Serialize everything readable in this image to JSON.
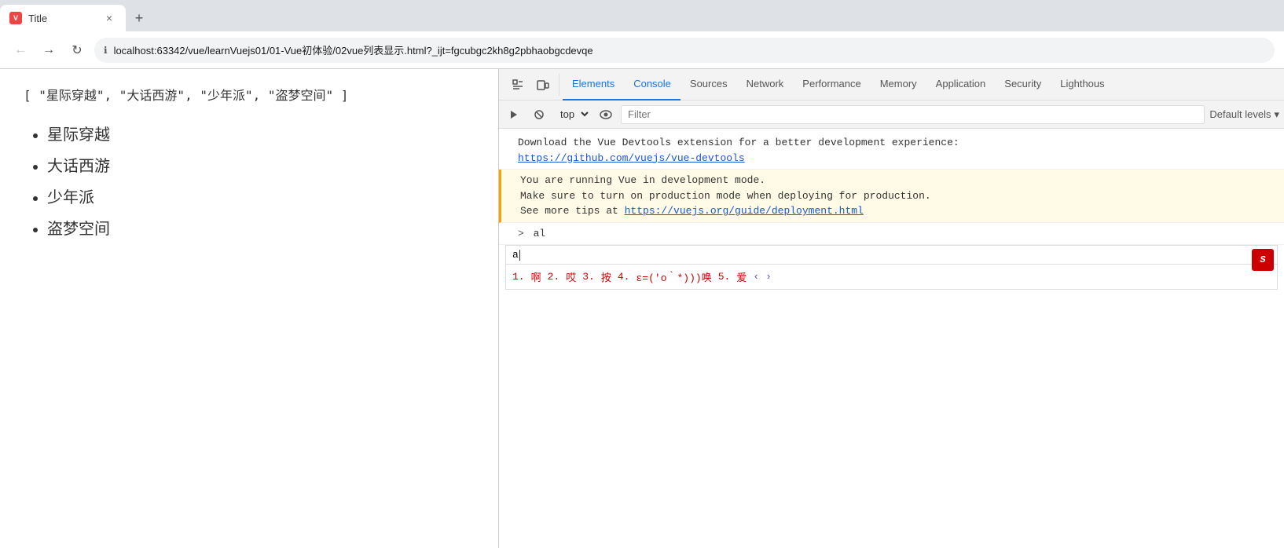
{
  "browser": {
    "tab": {
      "favicon_text": "V",
      "title": "Title",
      "close_label": "×",
      "new_tab_label": "+"
    },
    "nav": {
      "back_label": "←",
      "forward_label": "→",
      "reload_label": "↻",
      "url_icon": "ℹ",
      "url": "localhost:63342/vue/learnVuejs01/01-Vue初体验/02vue列表显示.html?_ijt=fgcubgc2kh8g2pbhaobgcdevqe"
    }
  },
  "page": {
    "array_text": "[ \"星际穿越\", \"大话西游\", \"少年派\", \"盗梦空间\" ]",
    "list_items": [
      "星际穿越",
      "大话西游",
      "少年派",
      "盗梦空间"
    ]
  },
  "devtools": {
    "tabs": [
      "Elements",
      "Console",
      "Sources",
      "Network",
      "Performance",
      "Memory",
      "Application",
      "Security",
      "Lighthous"
    ],
    "active_tab": "Console",
    "toolbar": {
      "context_selector": "top",
      "filter_placeholder": "Filter",
      "default_levels": "Default levels",
      "default_levels_arrow": "▾"
    },
    "console": {
      "messages": [
        {
          "type": "info",
          "lines": [
            "Download the Vue Devtools extension for a better development experience:",
            "link:https://github.com/vuejs/vue-devtools"
          ]
        },
        {
          "type": "warning",
          "lines": [
            "You are running Vue in development mode.",
            "Make sure to turn on production mode when deploying for production.",
            "See more tips at link:https://vuejs.org/guide/deployment.html"
          ]
        }
      ],
      "prompt_prefix": ">",
      "prompt_log": "al",
      "input_value": "a",
      "autocomplete": {
        "items": [
          {
            "num": "1.",
            "text": "啊"
          },
          {
            "num": "2.",
            "text": "哎"
          },
          {
            "num": "3.",
            "text": "按"
          },
          {
            "num": "4.",
            "text": "ε=(′ο｀*)))唤"
          },
          {
            "num": "5.",
            "text": "爱"
          }
        ],
        "nav_prev": "‹",
        "nav_next": "›"
      }
    }
  }
}
